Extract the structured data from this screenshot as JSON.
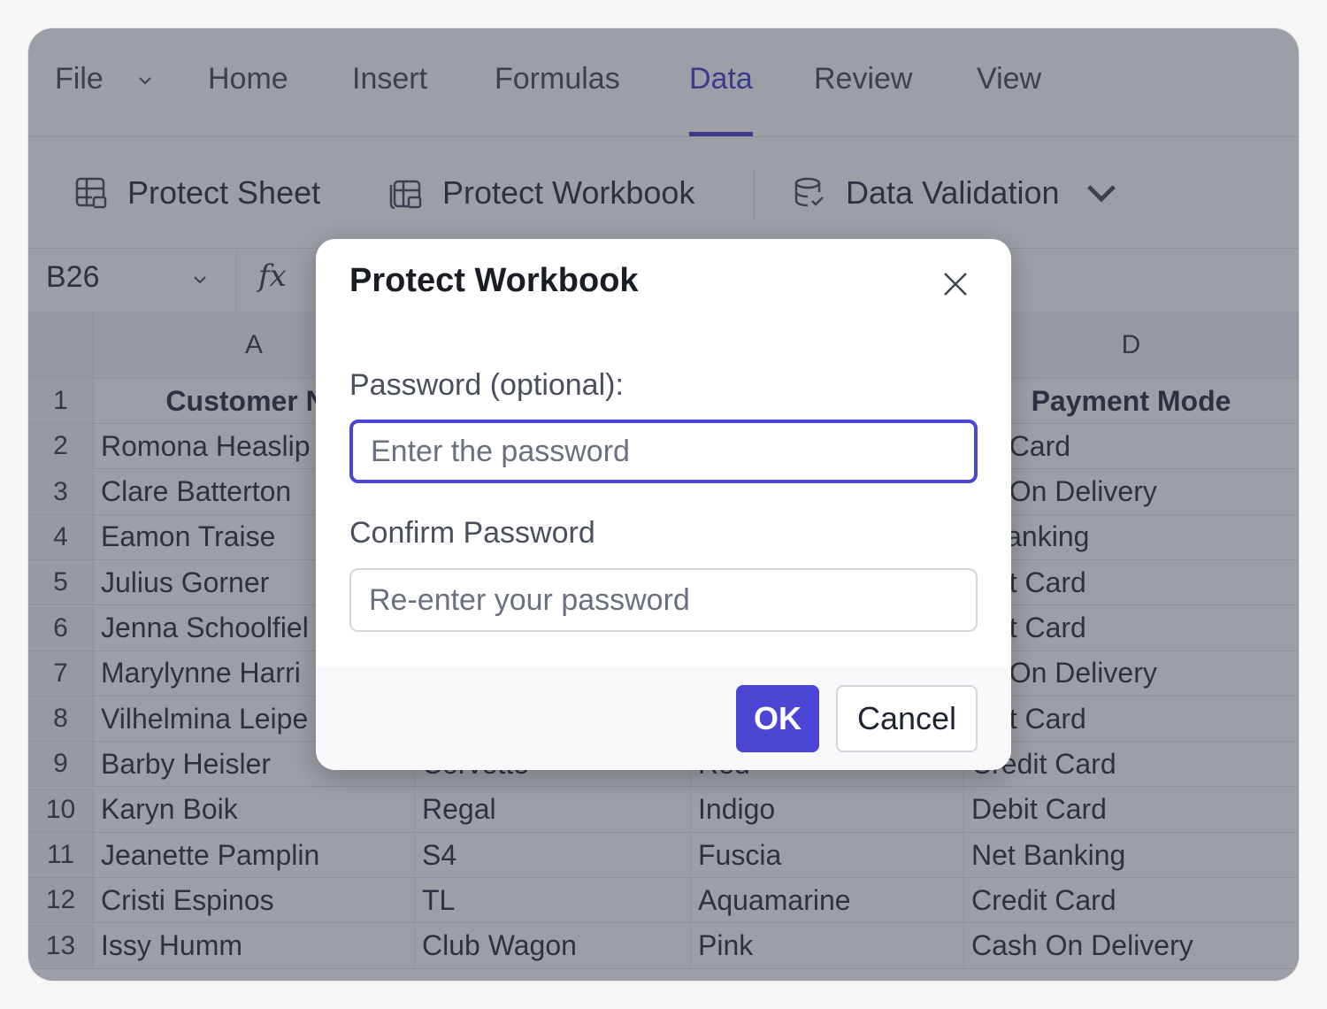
{
  "ribbon": {
    "tabs": [
      {
        "label": "File"
      },
      {
        "label": "Home"
      },
      {
        "label": "Insert"
      },
      {
        "label": "Formulas"
      },
      {
        "label": "Data"
      },
      {
        "label": "Review"
      },
      {
        "label": "View"
      }
    ],
    "active_tab": "Data",
    "accent_color": "#3a35c9"
  },
  "toolbar": {
    "protect_sheet": "Protect Sheet",
    "protect_workbook": "Protect Workbook",
    "data_validation": "Data Validation"
  },
  "formula_bar": {
    "cell_ref": "B26",
    "fx": "fx"
  },
  "sheet": {
    "columns": [
      "A",
      "D"
    ],
    "rows": [
      {
        "n": "1",
        "a": "Customer Na",
        "b": "",
        "c": "",
        "d": "Payment Mode"
      },
      {
        "n": "2",
        "a": "Romona Heaslip",
        "b": "",
        "c": "",
        "d": "bit Card"
      },
      {
        "n": "3",
        "a": "Clare Batterton",
        "b": "",
        "c": "",
        "d": "sh On Delivery"
      },
      {
        "n": "4",
        "a": "Eamon Traise",
        "b": "",
        "c": "",
        "d": "t Banking"
      },
      {
        "n": "5",
        "a": "Julius Gorner",
        "b": "",
        "c": "",
        "d": "edit Card"
      },
      {
        "n": "6",
        "a": "Jenna Schoolfiel",
        "b": "",
        "c": "",
        "d": "edit Card"
      },
      {
        "n": "7",
        "a": "Marylynne Harri",
        "b": "",
        "c": "",
        "d": "sh On Delivery"
      },
      {
        "n": "8",
        "a": "Vilhelmina Leipe",
        "b": "",
        "c": "",
        "d": "edit Card"
      },
      {
        "n": "9",
        "a": "Barby Heisler",
        "b": "Corvette",
        "c": "Red",
        "d": "Credit Card"
      },
      {
        "n": "10",
        "a": "Karyn Boik",
        "b": "Regal",
        "c": "Indigo",
        "d": "Debit Card"
      },
      {
        "n": "11",
        "a": "Jeanette Pamplin",
        "b": "S4",
        "c": "Fuscia",
        "d": "Net Banking"
      },
      {
        "n": "12",
        "a": "Cristi Espinos",
        "b": "TL",
        "c": "Aquamarine",
        "d": "Credit Card"
      },
      {
        "n": "13",
        "a": "Issy Humm",
        "b": "Club Wagon",
        "c": "Pink",
        "d": "Cash On Delivery"
      }
    ]
  },
  "dialog": {
    "title": "Protect Workbook",
    "password_label": "Password (optional):",
    "password_placeholder": "Enter the password",
    "confirm_label": "Confirm Password",
    "confirm_placeholder": "Re-enter your password",
    "ok_label": "OK",
    "cancel_label": "Cancel",
    "primary_color": "#4b45d6"
  }
}
